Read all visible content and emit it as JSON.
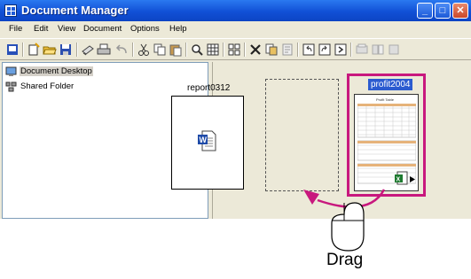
{
  "window": {
    "title": "Document Manager"
  },
  "menu": {
    "items": [
      "File",
      "Edit",
      "View",
      "Document",
      "Options",
      "Help"
    ]
  },
  "toolbar": {
    "buttons": [
      "app-icon",
      "new-icon",
      "open-icon",
      "save-icon",
      "scan-icon",
      "print-icon",
      "undo-icon",
      "cut-icon",
      "copy-icon",
      "paste-icon",
      "zoom-icon",
      "grid-icon",
      "tile-icon",
      "delete-icon",
      "duplicate-icon",
      "properties-icon",
      "rotate-left-icon",
      "rotate-right-icon",
      "next-page-icon",
      "misc-icon-1",
      "misc-icon-2",
      "misc-icon-3"
    ]
  },
  "tree": {
    "items": [
      {
        "label": "Document Desktop",
        "icon": "desktop-icon",
        "selected": true
      },
      {
        "label": "Shared Folder",
        "icon": "shared-folder-icon",
        "selected": false
      }
    ]
  },
  "documents": [
    {
      "name": "report0312",
      "type": "word-document"
    },
    {
      "name": "profit2004",
      "type": "spreadsheet",
      "selected": true,
      "thumbnail_title": "Profit Table"
    }
  ],
  "annotation": {
    "label": "Drag"
  },
  "colors": {
    "selection": "#c8187e",
    "titlebar": "#1150d6",
    "label_highlight": "#2b5bd0"
  }
}
